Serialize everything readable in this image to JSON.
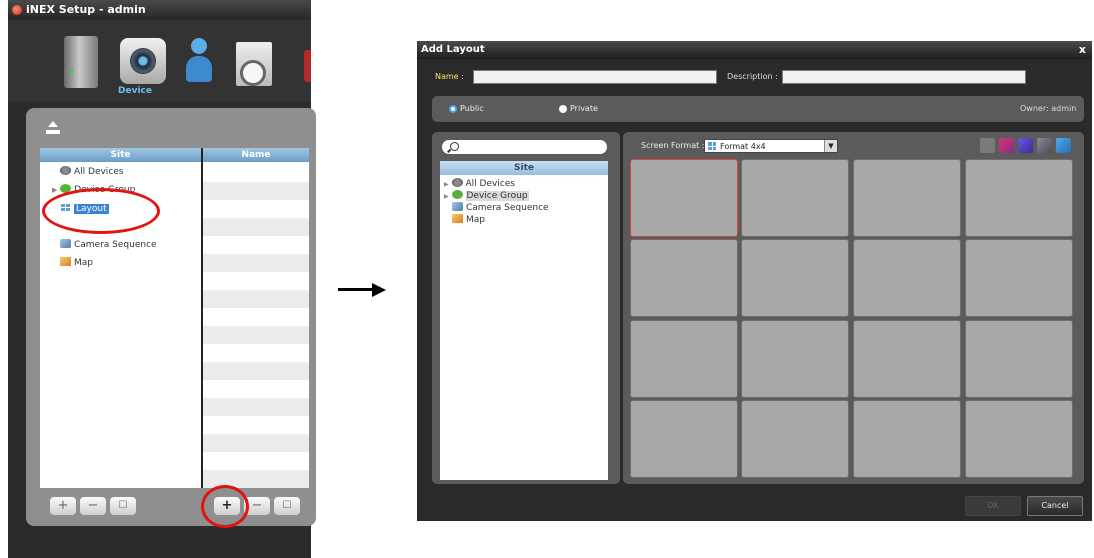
{
  "left_window": {
    "title": "iNEX Setup - admin",
    "toolbar": {
      "active_label": "Device"
    },
    "site_header": "Site",
    "name_header": "Name",
    "tree": [
      {
        "label": "All Devices"
      },
      {
        "label": "Device Group"
      },
      {
        "label": "Layout"
      },
      {
        "label": "Camera Sequence"
      },
      {
        "label": "Map"
      }
    ],
    "bottom_buttons": {
      "add": "+",
      "remove": "−",
      "edit": "☐"
    }
  },
  "dialog": {
    "title": "Add Layout",
    "close": "x",
    "name_label": "Name :",
    "name_value": "",
    "description_label": "Description :",
    "description_value": "",
    "visibility": {
      "public_label": "Public",
      "private_label": "Private",
      "selected": "Public",
      "owner": "Owner: admin"
    },
    "tree": {
      "header": "Site",
      "items": [
        {
          "label": "All Devices"
        },
        {
          "label": "Device Group"
        },
        {
          "label": "Camera Sequence"
        },
        {
          "label": "Map"
        }
      ]
    },
    "screen_format_label": "Screen Format :",
    "screen_format_value": "Format 4x4",
    "ok_label": "OK",
    "cancel_label": "Cancel"
  },
  "colors": {
    "annotation_ring": "#e1140f",
    "accent": "#3b82d4",
    "name_label": "#ffe066"
  }
}
